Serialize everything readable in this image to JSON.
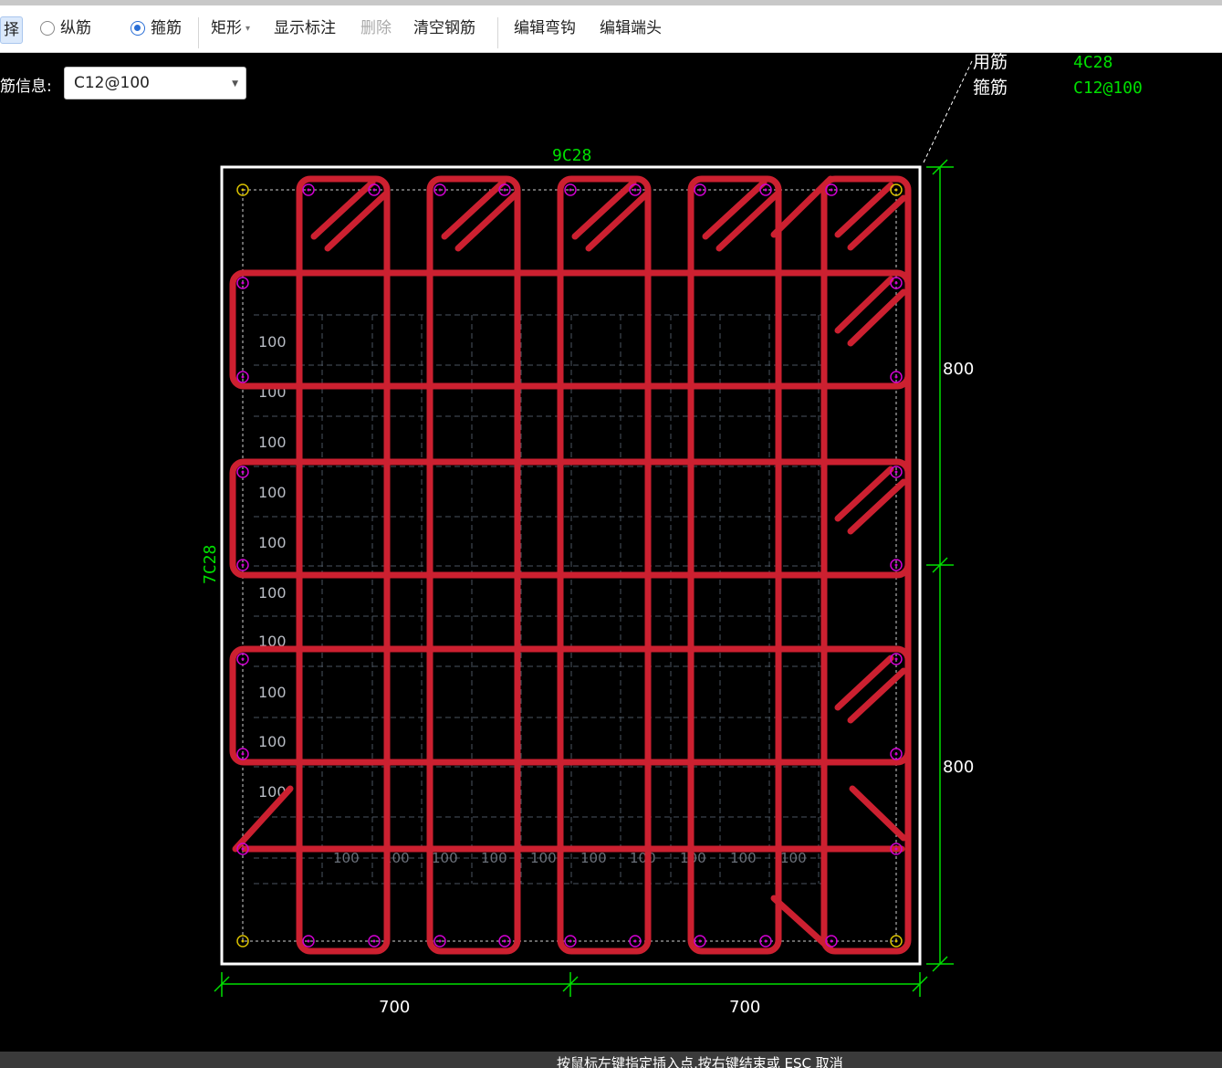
{
  "toolbar": {
    "select_label": "择",
    "radio_longitudinal": "纵筋",
    "radio_stirrup": "箍筋",
    "shape": "矩形",
    "show_annotation": "显示标注",
    "delete": "删除",
    "clear_rebar": "清空钢筋",
    "edit_hook": "编辑弯钩",
    "edit_end": "编辑端头"
  },
  "rebar_info": {
    "label": "筋信息:",
    "value": "C12@100"
  },
  "legend": {
    "corner_label": "用筋",
    "corner_value": "4C28",
    "stirrup_label": "箍筋",
    "stirrup_value": "C12@100"
  },
  "annotations": {
    "top_bars": "9C28",
    "side_bars": "7C28",
    "dim_bottom_left": "700",
    "dim_bottom_right": "700",
    "dim_right_top": "800",
    "dim_right_bottom": "800",
    "spacing_label": "100"
  },
  "status_text": "按鼠标左键指定插入点,按右键结束或 ESC 取消",
  "colors": {
    "rebar": "#cc2030",
    "annotation": "#00e000",
    "section": "#ffffff",
    "bar_node": "#d000d0",
    "corner_node": "#d8c000"
  }
}
